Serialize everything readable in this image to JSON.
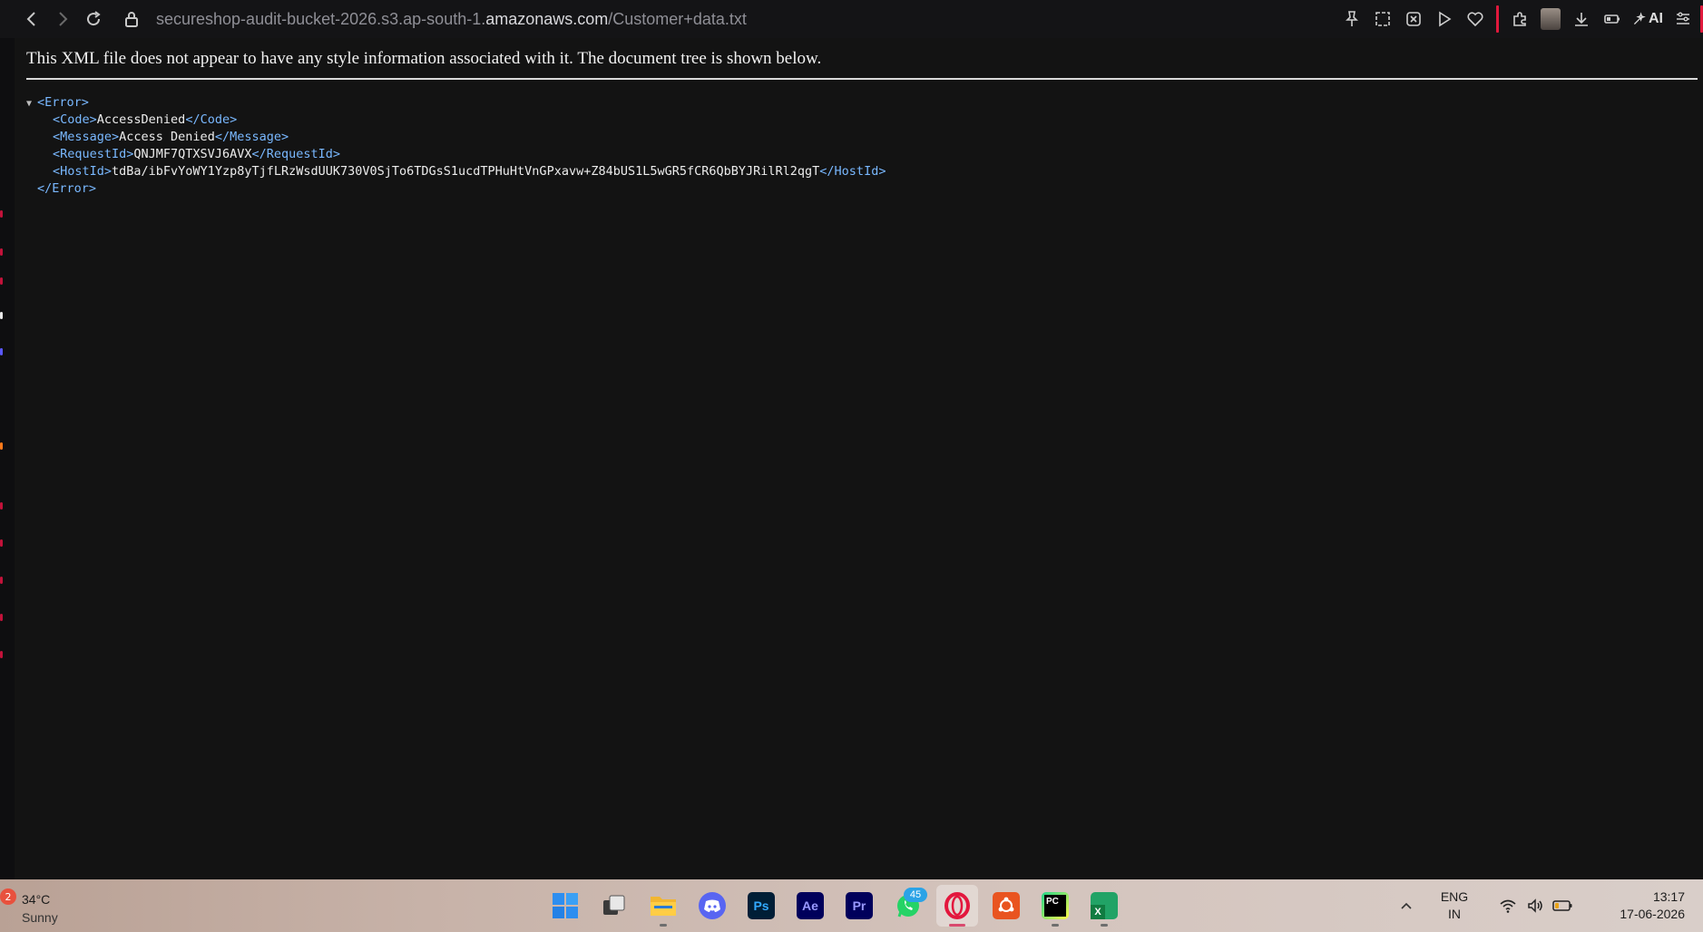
{
  "browser": {
    "url_prefix": "secureshop-audit-bucket-2026.s3.ap-south-1.",
    "url_host": "amazonaws.com",
    "url_path": "/Customer+data.txt",
    "ai_label": "AI"
  },
  "page": {
    "notice": "This XML file does not appear to have any style information associated with it. The document tree is shown below.",
    "xml": {
      "root_open": "<Error>",
      "root_close": "</Error>",
      "code_open": "<Code>",
      "code_value": "AccessDenied",
      "code_close": "</Code>",
      "message_open": "<Message>",
      "message_value": "Access Denied",
      "message_close": "</Message>",
      "requestid_open": "<RequestId>",
      "requestid_value": "QNJMF7QTXSVJ6AVX",
      "requestid_close": "</RequestId>",
      "hostid_open": "<HostId>",
      "hostid_value": "tdBa/ibFvYoWY1Yzp8yTjfLRzWsdUUK730V0SjTo6TDGsS1ucdTPHuHtVnGPxavw+Z84bUS1L5wGR5fCR6QbBYJRilRl2qgT",
      "hostid_close": "</HostId>"
    }
  },
  "taskbar": {
    "weather_badge": "2",
    "temperature": "34°C",
    "condition": "Sunny",
    "apps": {
      "photoshop": "Ps",
      "after_effects": "Ae",
      "premiere": "Pr",
      "pycharm": "PC",
      "excel": "X",
      "whatsapp_badge": "45"
    },
    "lang_top": "ENG",
    "lang_bottom": "IN",
    "time": "13:17",
    "date": "17-06-2026"
  },
  "colors": {
    "xml_tag": "#79b8ff",
    "accent_red": "#e0193c",
    "page_bg": "#131313"
  }
}
